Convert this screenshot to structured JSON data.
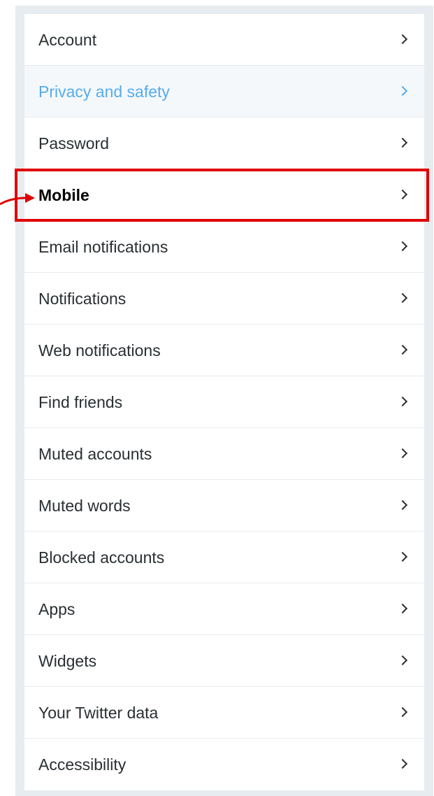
{
  "settings_menu": {
    "items": [
      {
        "label": "Account"
      },
      {
        "label": "Privacy and safety"
      },
      {
        "label": "Password"
      },
      {
        "label": "Mobile"
      },
      {
        "label": "Email notifications"
      },
      {
        "label": "Notifications"
      },
      {
        "label": "Web notifications"
      },
      {
        "label": "Find friends"
      },
      {
        "label": "Muted accounts"
      },
      {
        "label": "Muted words"
      },
      {
        "label": "Blocked accounts"
      },
      {
        "label": "Apps"
      },
      {
        "label": "Widgets"
      },
      {
        "label": "Your Twitter data"
      },
      {
        "label": "Accessibility"
      }
    ],
    "active_item": "Privacy and safety",
    "highlighted_item": "Mobile"
  },
  "colors": {
    "panel_background": "#e6ecf0",
    "active_text": "#55acee",
    "active_row_background": "#f5f8fa",
    "default_text": "#292f33",
    "annotation_red": "#e00000"
  }
}
